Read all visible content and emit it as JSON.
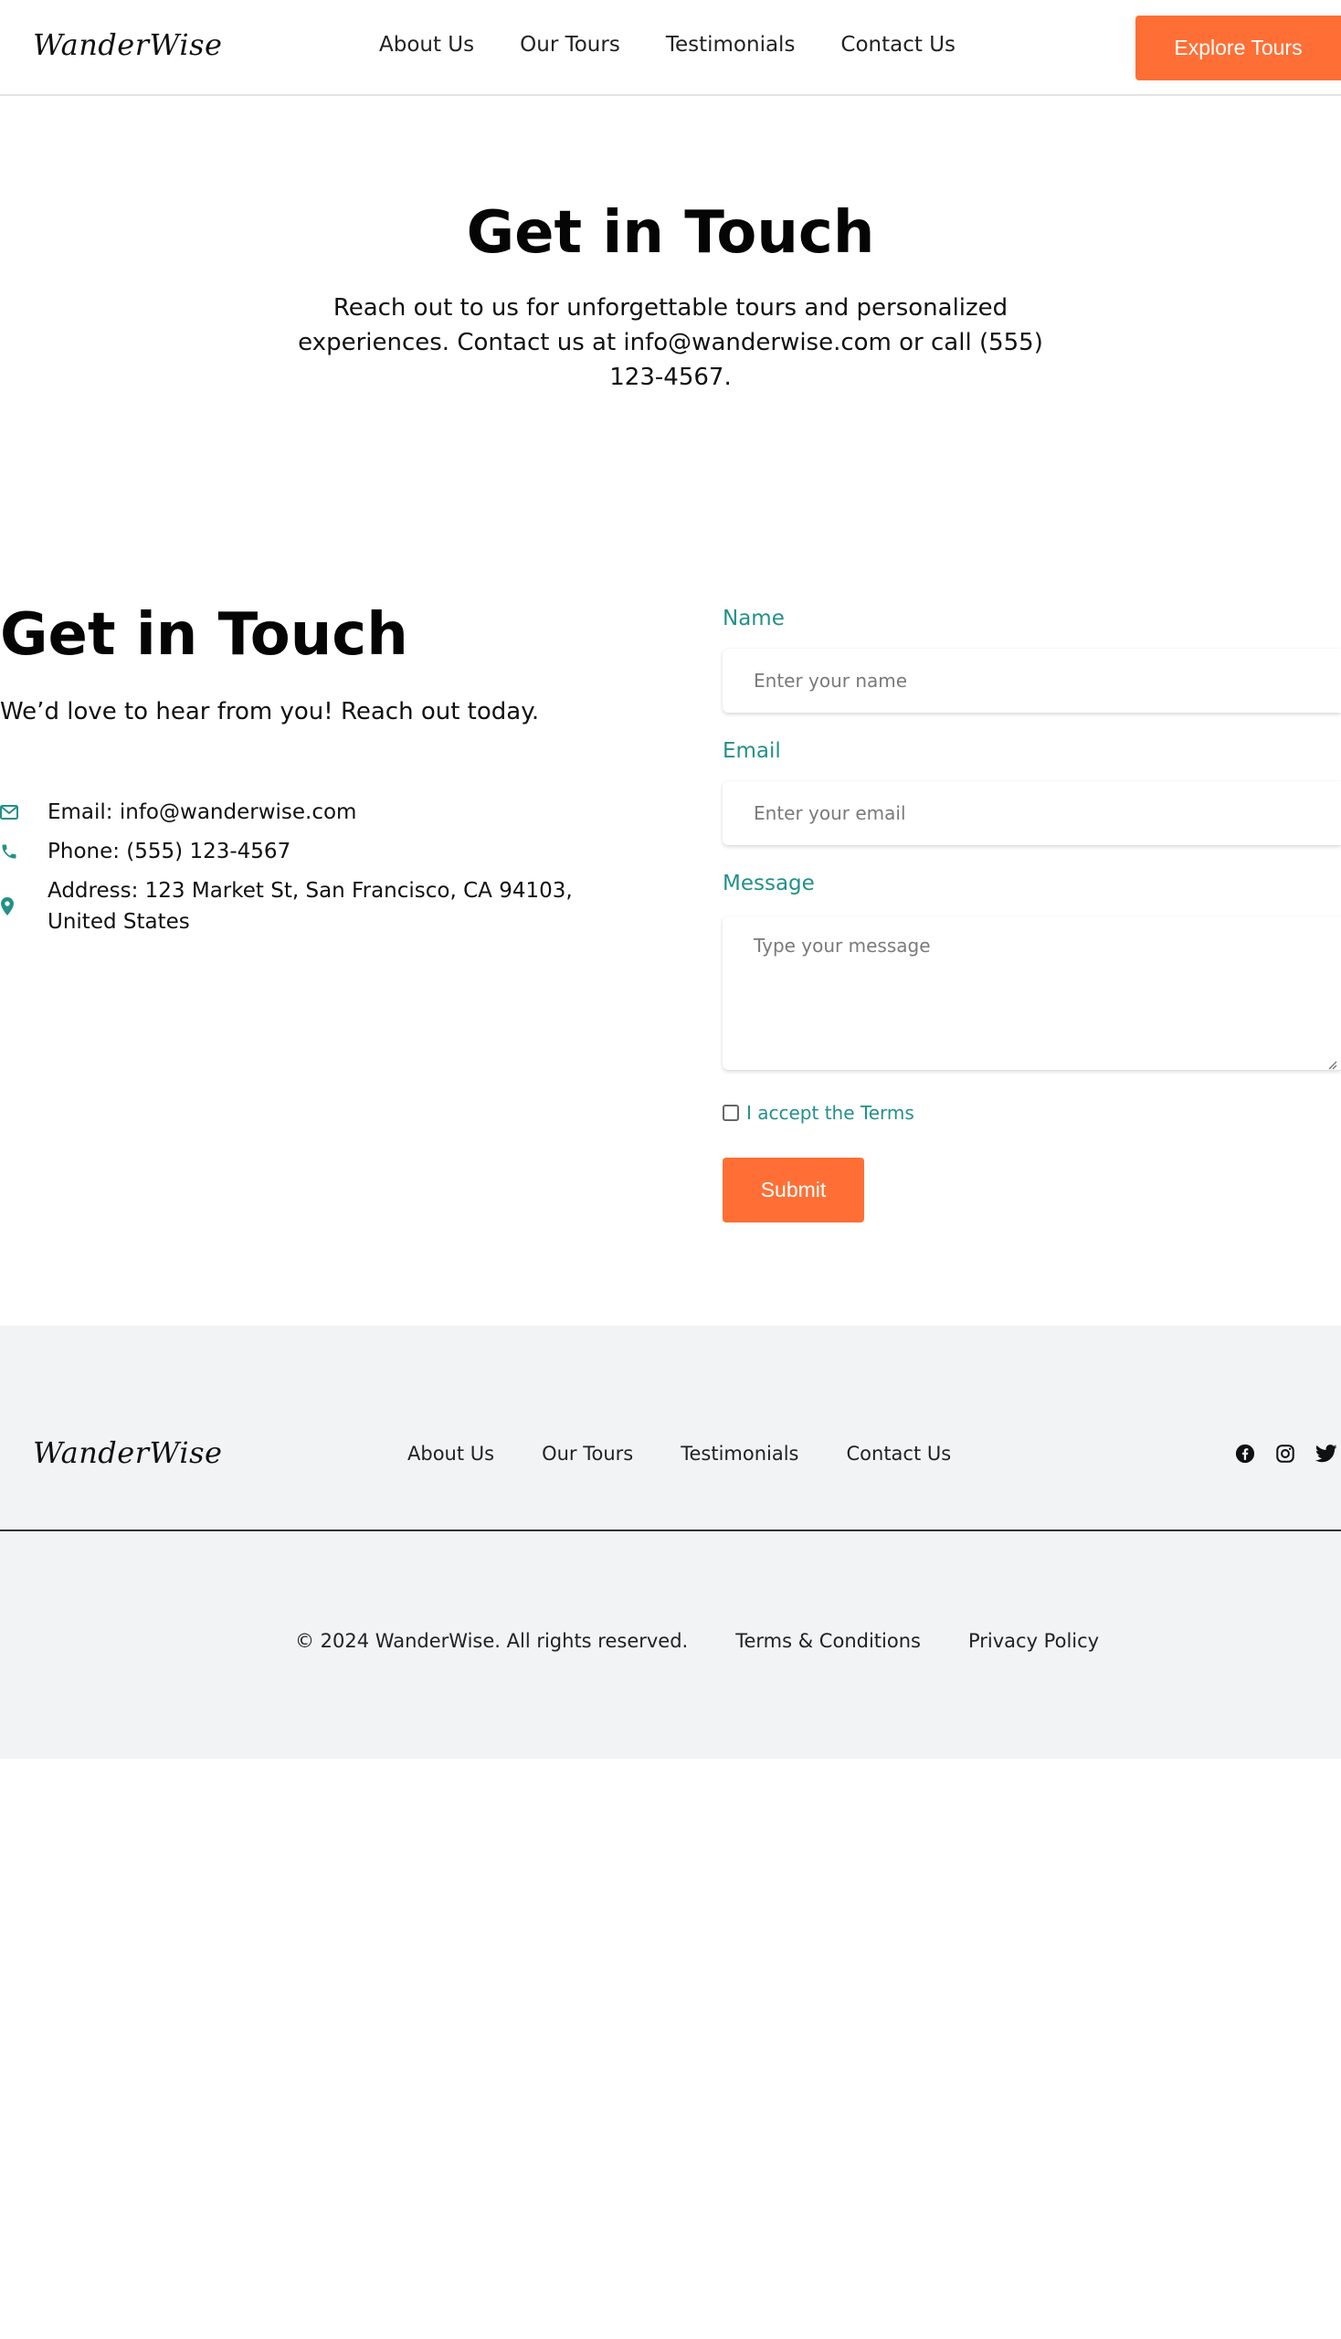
{
  "brand": {
    "logo": "WanderWise",
    "accent": "#ff6f35",
    "label_color": "#23908a"
  },
  "header": {
    "nav": [
      "About Us",
      "Our Tours",
      "Testimonials",
      "Contact Us"
    ],
    "cta": "Explore Tours"
  },
  "hero": {
    "title": "Get in Touch",
    "subtitle": "Reach out to us for unforgettable tours and personalized experiences. Contact us at info@wanderwise.com or call (555) 123-4567."
  },
  "contact": {
    "title": "Get in Touch",
    "subtitle": "We’d love to hear from you! Reach out today.",
    "items": [
      {
        "icon": "envelope-icon",
        "text": "Email: info@wanderwise.com"
      },
      {
        "icon": "phone-icon",
        "text": "Phone: (555) 123-4567"
      },
      {
        "icon": "map-pin-icon",
        "text": "Address: 123 Market St, San Francisco, CA 94103, United States"
      }
    ]
  },
  "form": {
    "name_label": "Name",
    "name_placeholder": "Enter your name",
    "email_label": "Email",
    "email_placeholder": "Enter your email",
    "message_label": "Message",
    "message_placeholder": "Type your message",
    "terms_label": "I accept the Terms",
    "submit": "Submit"
  },
  "footer": {
    "logo": "WanderWise",
    "nav": [
      "About Us",
      "Our Tours",
      "Testimonials",
      "Contact Us"
    ],
    "social": [
      "facebook-icon",
      "instagram-icon",
      "twitter-icon"
    ],
    "copyright": "© 2024 WanderWise. All rights reserved.",
    "terms": "Terms & Conditions",
    "privacy": "Privacy Policy"
  }
}
